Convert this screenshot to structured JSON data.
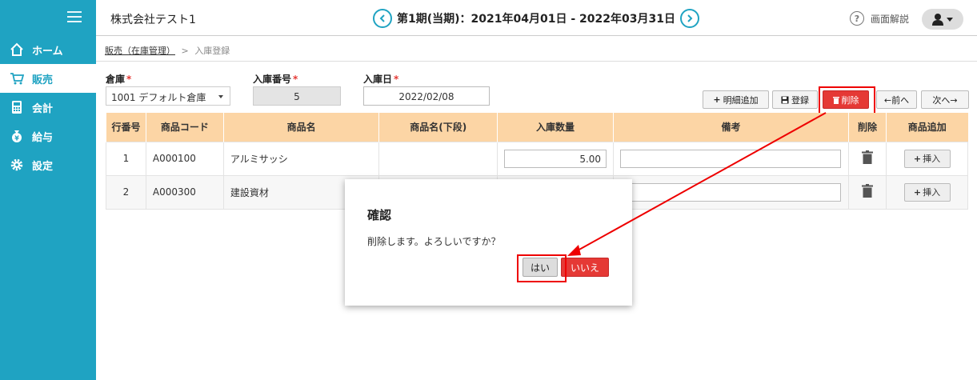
{
  "sidebar": {
    "items": [
      {
        "label": "ホーム",
        "icon": "home-icon"
      },
      {
        "label": "販売",
        "icon": "cart-icon"
      },
      {
        "label": "会計",
        "icon": "calculator-icon"
      },
      {
        "label": "給与",
        "icon": "yen-bag-icon"
      },
      {
        "label": "設定",
        "icon": "gear-icon"
      }
    ]
  },
  "header": {
    "company": "株式会社テスト1",
    "period": "第1期(当期)：2021年04月01日 - 2022年03月31日",
    "help_label": "画面解説"
  },
  "breadcrumb": {
    "parent": "販売（在庫管理）",
    "separator": ">",
    "current": "入庫登録"
  },
  "form": {
    "warehouse_label": "倉庫",
    "warehouse_value": "1001 デフォルト倉庫",
    "receipt_no_label": "入庫番号",
    "receipt_no_value": "5",
    "date_label": "入庫日",
    "date_value": "2022/02/08",
    "required_mark": "*"
  },
  "toolbar": {
    "add_detail": "明細追加",
    "register": "登録",
    "delete": "削除",
    "prev": "←前へ",
    "next": "次へ→"
  },
  "table": {
    "headers": [
      "行番号",
      "商品コード",
      "商品名",
      "商品名(下段)",
      "入庫数量",
      "備考",
      "削除",
      "商品追加"
    ],
    "rows": [
      {
        "row": "1",
        "code": "A000100",
        "name": "アルミサッシ",
        "name2": "",
        "qty": "5.00",
        "note": "",
        "insert": "挿入"
      },
      {
        "row": "2",
        "code": "A000300",
        "name": "建設資材",
        "name2": "",
        "qty": "",
        "note": "",
        "insert": "挿入"
      }
    ]
  },
  "dialog": {
    "title": "確認",
    "message": "削除します。よろしいですか？",
    "yes": "はい",
    "no": "いいえ"
  },
  "colors": {
    "sidebar": "#1fa3c2",
    "table_header": "#fcd5a5",
    "danger": "#e53935",
    "annotation": "#ee0000"
  }
}
